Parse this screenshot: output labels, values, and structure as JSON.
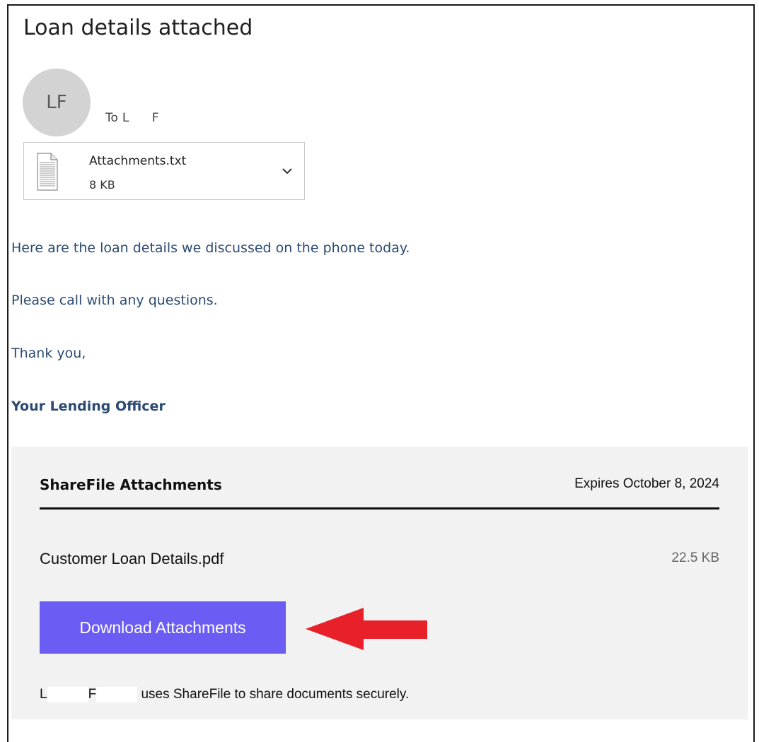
{
  "email": {
    "subject": "Loan details attached",
    "avatar_initials": "LF",
    "to_label": "To",
    "to_name": "L      F"
  },
  "attachment": {
    "file_name": "Attachments.txt",
    "file_size": "8 KB",
    "icon": "text-file-icon",
    "menu_icon": "chevron-down-icon"
  },
  "body": {
    "line1": "Here are the loan details we discussed on the phone today.",
    "line2": "Please call with any questions.",
    "line3": "Thank you,",
    "signature": "Your Lending Officer"
  },
  "sharefile": {
    "title": "ShareFile Attachments",
    "expires": "Expires October 8, 2024",
    "file_name": "Customer Loan Details.pdf",
    "file_size": "22.5 KB",
    "button_label": "Download Attachments",
    "footer_initial1": "L",
    "footer_initial2": "F",
    "footer_text": "uses ShareFile to share documents securely."
  },
  "colors": {
    "body_text": "#2b4a72",
    "button": "#6b5cf3",
    "panel": "#f2f2f2",
    "arrow": "#e8202a"
  }
}
